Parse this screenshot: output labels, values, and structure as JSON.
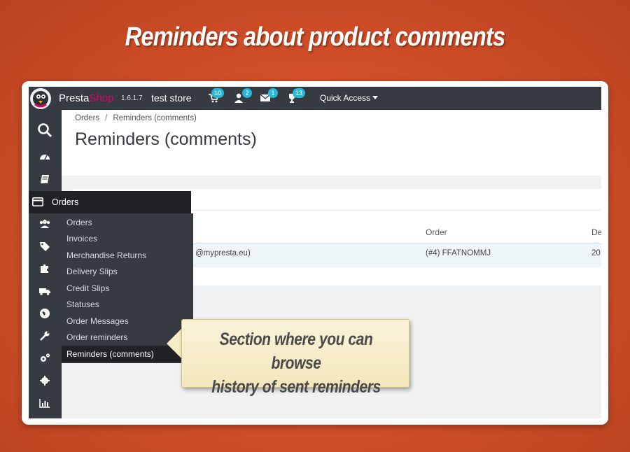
{
  "headline": "Reminders about product comments",
  "topbar": {
    "brand_presta": "Presta",
    "brand_shop": "Shop",
    "version": "1.6.1.7",
    "store": "test store",
    "badges": {
      "orders": "10",
      "customers": "2",
      "messages": "1",
      "trophy": "13"
    },
    "quick_access": "Quick Access"
  },
  "breadcrumb": {
    "parent": "Orders",
    "sep": "/",
    "current": "Reminders (comments)"
  },
  "page_title": "Reminders (comments)",
  "table": {
    "columns": {
      "order": "Order",
      "date": "De"
    },
    "row": {
      "email": "@mypresta.eu)",
      "order": "(#4) FFATNOMMJ",
      "date": "20"
    }
  },
  "menu": {
    "header": "Orders",
    "items": [
      "Orders",
      "Invoices",
      "Merchandise Returns",
      "Delivery Slips",
      "Credit Slips",
      "Statuses",
      "Order Messages",
      "Order reminders",
      "Reminders (comments)"
    ],
    "active_index": 8
  },
  "callout": {
    "line1": "Section where you can browse",
    "line2": "history of  sent reminders"
  },
  "colors": {
    "accent": "#25b9d7",
    "brand_pink": "#df0067",
    "dark": "#363a41"
  }
}
